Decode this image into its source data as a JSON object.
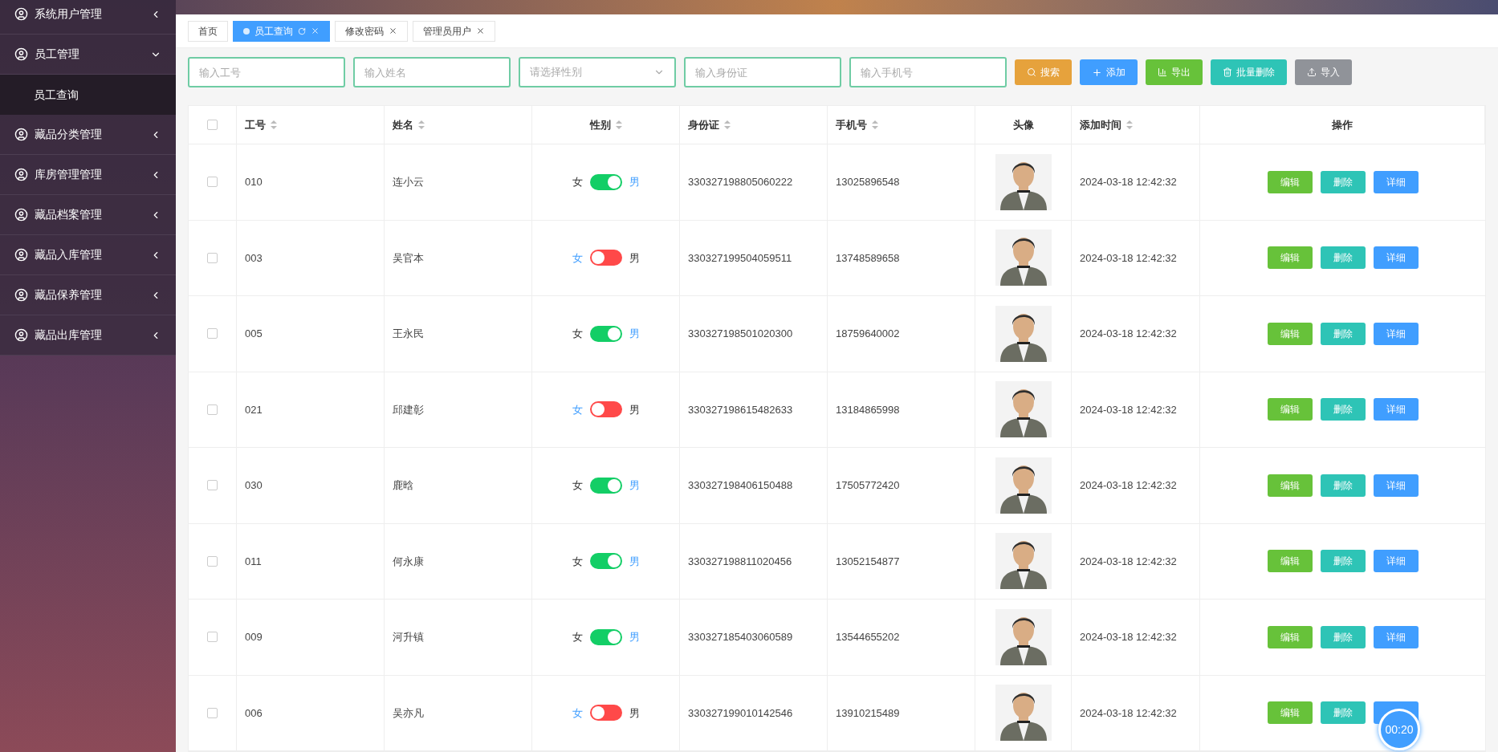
{
  "sidebar": {
    "items": [
      {
        "label": "系统用户管理",
        "expanded": false
      },
      {
        "label": "员工管理",
        "expanded": true,
        "children": [
          {
            "label": "员工查询",
            "selected": true
          }
        ]
      },
      {
        "label": "藏品分类管理",
        "expanded": false
      },
      {
        "label": "库房管理管理",
        "expanded": false
      },
      {
        "label": "藏品档案管理",
        "expanded": false
      },
      {
        "label": "藏品入库管理",
        "expanded": false
      },
      {
        "label": "藏品保养管理",
        "expanded": false
      },
      {
        "label": "藏品出库管理",
        "expanded": false
      }
    ]
  },
  "tabs": [
    {
      "label": "首页",
      "selected": false,
      "closable": false
    },
    {
      "label": "员工查询",
      "selected": true,
      "closable": true
    },
    {
      "label": "修改密码",
      "selected": false,
      "closable": true
    },
    {
      "label": "管理员用户",
      "selected": false,
      "closable": true
    }
  ],
  "filters": [
    {
      "kind": "input",
      "placeholder": "输入工号"
    },
    {
      "kind": "input",
      "placeholder": "输入姓名"
    },
    {
      "kind": "select",
      "placeholder": "请选择性别"
    },
    {
      "kind": "input",
      "placeholder": "输入身份证"
    },
    {
      "kind": "input",
      "placeholder": "输入手机号"
    }
  ],
  "toolbar_buttons": [
    {
      "label": "搜索",
      "kind": "search"
    },
    {
      "label": "添加",
      "kind": "add"
    },
    {
      "label": "导出",
      "kind": "export"
    },
    {
      "label": "批量删除",
      "kind": "batch_delete"
    },
    {
      "label": "导入",
      "kind": "import"
    }
  ],
  "table": {
    "columns": [
      {
        "label": "工号",
        "sortable": true
      },
      {
        "label": "姓名",
        "sortable": true
      },
      {
        "label": "性别",
        "sortable": true
      },
      {
        "label": "身份证",
        "sortable": true
      },
      {
        "label": "手机号",
        "sortable": true
      },
      {
        "label": "头像",
        "sortable": false
      },
      {
        "label": "添加时间",
        "sortable": true
      },
      {
        "label": "操作",
        "sortable": false
      }
    ],
    "header_checked": false,
    "rows": [
      {
        "checked": false,
        "id": "010",
        "name": "连小云",
        "gender": {
          "off_label": "女",
          "on_label": "男",
          "on": true
        },
        "id_card": "330327198805060222",
        "phone": "13025896548",
        "added": "2024-03-18 12:42:32",
        "actions": [
          {
            "kind": "edit",
            "label": "编辑"
          },
          {
            "kind": "delete",
            "label": "删除"
          },
          {
            "kind": "detail",
            "label": "详细"
          }
        ]
      },
      {
        "checked": false,
        "id": "003",
        "name": "吴官本",
        "gender": {
          "off_label": "女",
          "on_label": "男",
          "on": false
        },
        "id_card": "330327199504059511",
        "phone": "13748589658",
        "added": "2024-03-18 12:42:32",
        "actions": [
          {
            "kind": "edit",
            "label": "编辑"
          },
          {
            "kind": "delete",
            "label": "删除"
          },
          {
            "kind": "detail",
            "label": "详细"
          }
        ]
      },
      {
        "checked": false,
        "id": "005",
        "name": "王永民",
        "gender": {
          "off_label": "女",
          "on_label": "男",
          "on": true
        },
        "id_card": "330327198501020300",
        "phone": "18759640002",
        "added": "2024-03-18 12:42:32",
        "actions": [
          {
            "kind": "edit",
            "label": "编辑"
          },
          {
            "kind": "delete",
            "label": "删除"
          },
          {
            "kind": "detail",
            "label": "详细"
          }
        ]
      },
      {
        "checked": false,
        "id": "021",
        "name": "邱建彰",
        "gender": {
          "off_label": "女",
          "on_label": "男",
          "on": false
        },
        "id_card": "330327198615482633",
        "phone": "13184865998",
        "added": "2024-03-18 12:42:32",
        "actions": [
          {
            "kind": "edit",
            "label": "编辑"
          },
          {
            "kind": "delete",
            "label": "删除"
          },
          {
            "kind": "detail",
            "label": "详细"
          }
        ]
      },
      {
        "checked": false,
        "id": "030",
        "name": "鹿晗",
        "gender": {
          "off_label": "女",
          "on_label": "男",
          "on": true
        },
        "id_card": "330327198406150488",
        "phone": "17505772420",
        "added": "2024-03-18 12:42:32",
        "actions": [
          {
            "kind": "edit",
            "label": "编辑"
          },
          {
            "kind": "delete",
            "label": "删除"
          },
          {
            "kind": "detail",
            "label": "详细"
          }
        ]
      },
      {
        "checked": false,
        "id": "011",
        "name": "何永康",
        "gender": {
          "off_label": "女",
          "on_label": "男",
          "on": true
        },
        "id_card": "330327198811020456",
        "phone": "13052154877",
        "added": "2024-03-18 12:42:32",
        "actions": [
          {
            "kind": "edit",
            "label": "编辑"
          },
          {
            "kind": "delete",
            "label": "删除"
          },
          {
            "kind": "detail",
            "label": "详细"
          }
        ]
      },
      {
        "checked": false,
        "id": "009",
        "name": "河升镇",
        "gender": {
          "off_label": "女",
          "on_label": "男",
          "on": true
        },
        "id_card": "330327185403060589",
        "phone": "13544655202",
        "added": "2024-03-18 12:42:32",
        "actions": [
          {
            "kind": "edit",
            "label": "编辑"
          },
          {
            "kind": "delete",
            "label": "删除"
          },
          {
            "kind": "detail",
            "label": "详细"
          }
        ]
      },
      {
        "checked": false,
        "id": "006",
        "name": "吴亦凡",
        "gender": {
          "off_label": "女",
          "on_label": "男",
          "on": false
        },
        "id_card": "330327199010142546",
        "phone": "13910215489",
        "added": "2024-03-18 12:42:32",
        "actions": [
          {
            "kind": "edit",
            "label": "编辑"
          },
          {
            "kind": "delete",
            "label": "删除"
          },
          {
            "kind": "detail"
          }
        ]
      }
    ]
  },
  "timer": "00:20"
}
